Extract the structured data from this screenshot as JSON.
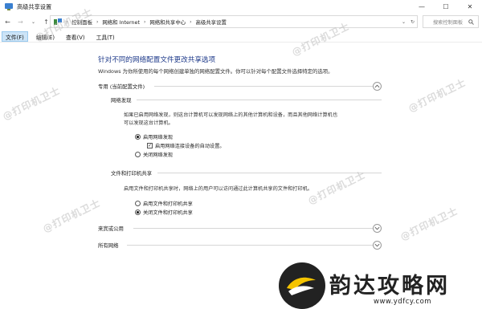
{
  "window": {
    "title": "高级共享设置",
    "minimize": "—",
    "maximize": "☐",
    "close": "✕"
  },
  "address": {
    "crumbs": [
      "控制面板",
      "网络和 Internet",
      "网络和共享中心",
      "高级共享设置"
    ],
    "separator": "›",
    "search_placeholder": "搜索控制面板"
  },
  "menu": {
    "items": [
      "文件(F)",
      "编辑(E)",
      "查看(V)",
      "工具(T)"
    ]
  },
  "main": {
    "title": "针对不同的网络配置文件更改共享选项",
    "description": "Windows 为你所使用的每个网络创建单独的网络配置文件。你可以针对每个配置文件选择特定的选项。",
    "private_profile": {
      "label": "专用 (当前配置文件)",
      "network_discovery": {
        "heading": "网络发现",
        "para_line1": "如果已启用网络发现，则这台计算机可以发现网络上的其他计算机和设备，而且其他网络计算机也",
        "para_line2": "可以发现这台计算机。",
        "option_on": "启用网络发现",
        "auto_setup": "启用网络连接设备的自动设置。",
        "option_off": "关闭网络发现"
      },
      "file_sharing": {
        "heading": "文件和打印机共享",
        "para": "启用文件和打印机共享时，网络上的用户可以访问通过此计算机共享的文件和打印机。",
        "option_on": "启用文件和打印机共享",
        "option_off": "关闭文件和打印机共享"
      }
    },
    "guest_profile": {
      "label": "来宾或公用"
    },
    "all_networks": {
      "label": "所有网络"
    }
  },
  "watermark": "@打印机卫士",
  "overlay": {
    "site_name": "韵达攻略网",
    "site_url": "www.ydfcy.com"
  }
}
